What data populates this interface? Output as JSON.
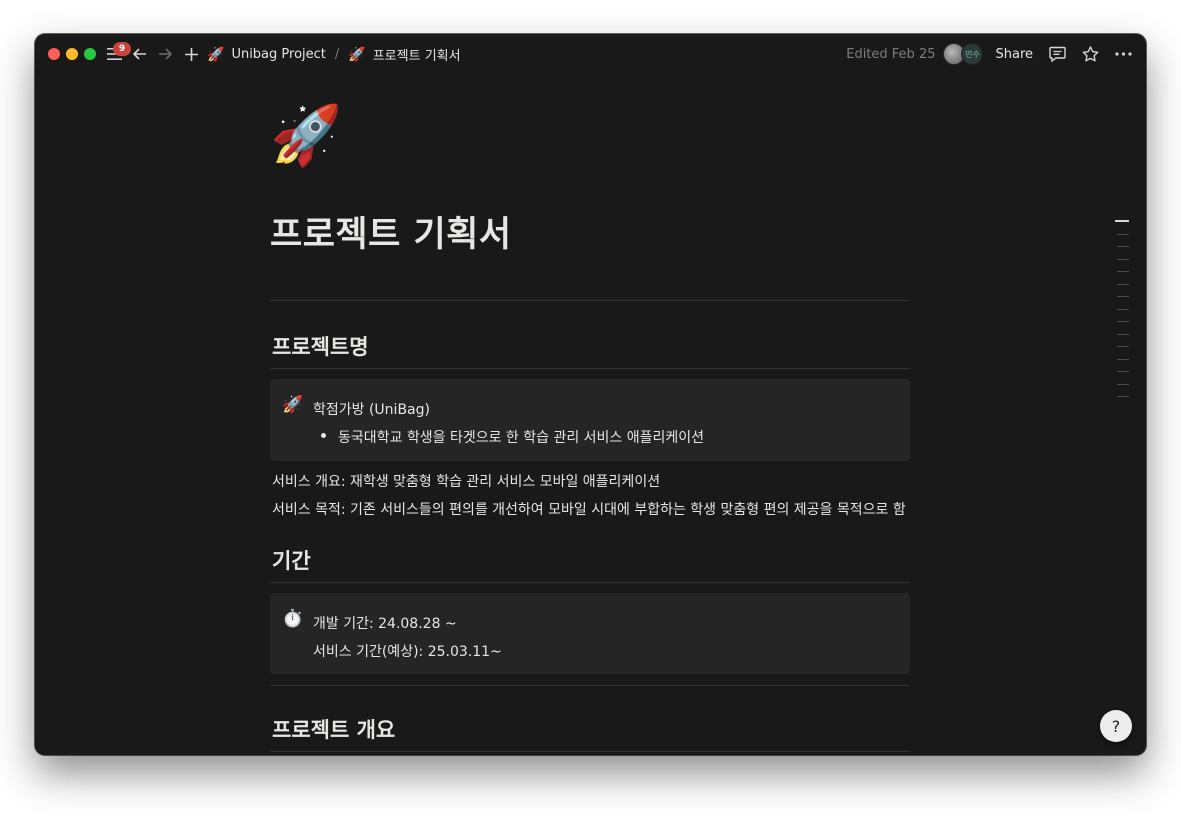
{
  "topbar": {
    "notification_count": "9",
    "breadcrumb": [
      {
        "label": "Unibag Project"
      },
      {
        "label": "프로젝트 기획서"
      }
    ],
    "breadcrumb_separator": "/",
    "edited": "Edited Feb 25",
    "avatar_initials": "민수",
    "share_label": "Share",
    "more_label": "···"
  },
  "page": {
    "icon": "🚀",
    "title": "프로젝트 기획서",
    "sections": [
      {
        "heading": "프로젝트명",
        "callout": {
          "icon": "🚀",
          "title": "학점가방 (UniBag)",
          "bullet": "동국대학교 학생을 타겟으로 한 학습 관리 서비스 애플리케이션"
        },
        "paragraphs": [
          "서비스 개요: 재학생 맞춤형 학습 관리 서비스 모바일 애플리케이션",
          "서비스 목적: 기존 서비스들의 편의를 개선하여 모바일 시대에 부합하는 학생 맞춤형 편의 제공을 목적으로 함"
        ]
      },
      {
        "heading": "기간",
        "callout": {
          "icon": "⏱️",
          "lines": [
            "개발 기간: 24.08.28 ~",
            "서비스 기간(예상): 25.03.11~"
          ]
        }
      },
      {
        "heading": "프로젝트 개요"
      }
    ]
  },
  "help_icon_glyph": "?",
  "colors": {
    "background": "#191919",
    "callout_bg": "#252525",
    "text": "#e6e6e5",
    "muted": "#7d7d7d",
    "badge": "#c9453c"
  }
}
